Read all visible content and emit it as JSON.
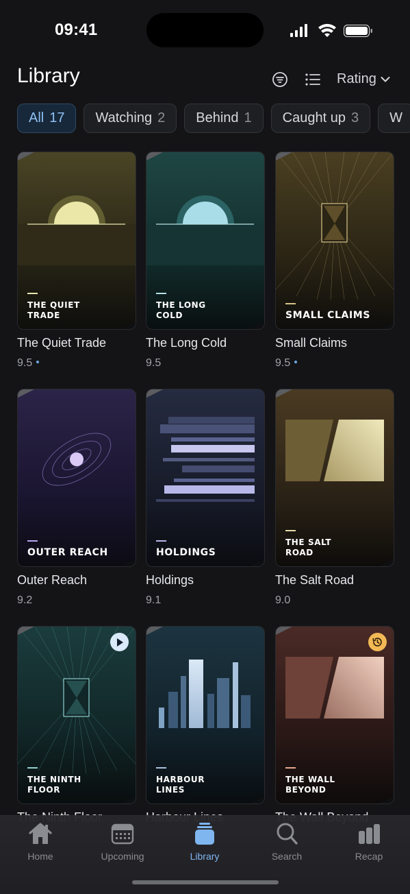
{
  "status": {
    "time": "09:41"
  },
  "header": {
    "title": "Library",
    "sort_label": "Rating",
    "filter_icon": "filter-circle-icon",
    "list_icon": "list-icon"
  },
  "filters": [
    {
      "label": "All",
      "count": "17",
      "active": true
    },
    {
      "label": "Watching",
      "count": "2"
    },
    {
      "label": "Behind",
      "count": "1"
    },
    {
      "label": "Caught up",
      "count": "3"
    },
    {
      "label": "W",
      "count": ""
    }
  ],
  "shows": [
    {
      "title": "The Quiet Trade",
      "tag_line1": "THE QUIET",
      "tag_line2": "TRADE",
      "rating": "9.5",
      "dot": true
    },
    {
      "title": "The Long Cold",
      "tag_line1": "THE LONG",
      "tag_line2": "COLD",
      "rating": "9.5",
      "dot": false
    },
    {
      "title": "Small Claims",
      "tag_line1": "SMALL CLAIMS",
      "tag_line2": "",
      "rating": "9.5",
      "dot": true
    },
    {
      "title": "Outer Reach",
      "tag_line1": "OUTER REACH",
      "tag_line2": "",
      "rating": "9.2",
      "dot": false
    },
    {
      "title": "Holdings",
      "tag_line1": "HOLDINGS",
      "tag_line2": "",
      "rating": "9.1",
      "dot": false
    },
    {
      "title": "The Salt Road",
      "tag_line1": "THE SALT",
      "tag_line2": "ROAD",
      "rating": "9.0",
      "dot": false
    },
    {
      "title": "The Ninth Floor",
      "tag_line1": "THE NINTH",
      "tag_line2": "FLOOR",
      "rating": "",
      "badge": "play-icon"
    },
    {
      "title": "Harbour Lines",
      "tag_line1": "HARBOUR",
      "tag_line2": "LINES",
      "rating": ""
    },
    {
      "title": "The Wall Beyond",
      "tag_line1": "THE WALL",
      "tag_line2": "BEYOND",
      "rating": "",
      "badge": "history-icon"
    }
  ],
  "tabs": [
    {
      "label": "Home",
      "icon": "house-icon"
    },
    {
      "label": "Upcoming",
      "icon": "calendar-icon"
    },
    {
      "label": "Library",
      "icon": "stack-icon",
      "active": true
    },
    {
      "label": "Search",
      "icon": "magnifier-icon"
    },
    {
      "label": "Recap",
      "icon": "bar-chart-icon"
    }
  ]
}
